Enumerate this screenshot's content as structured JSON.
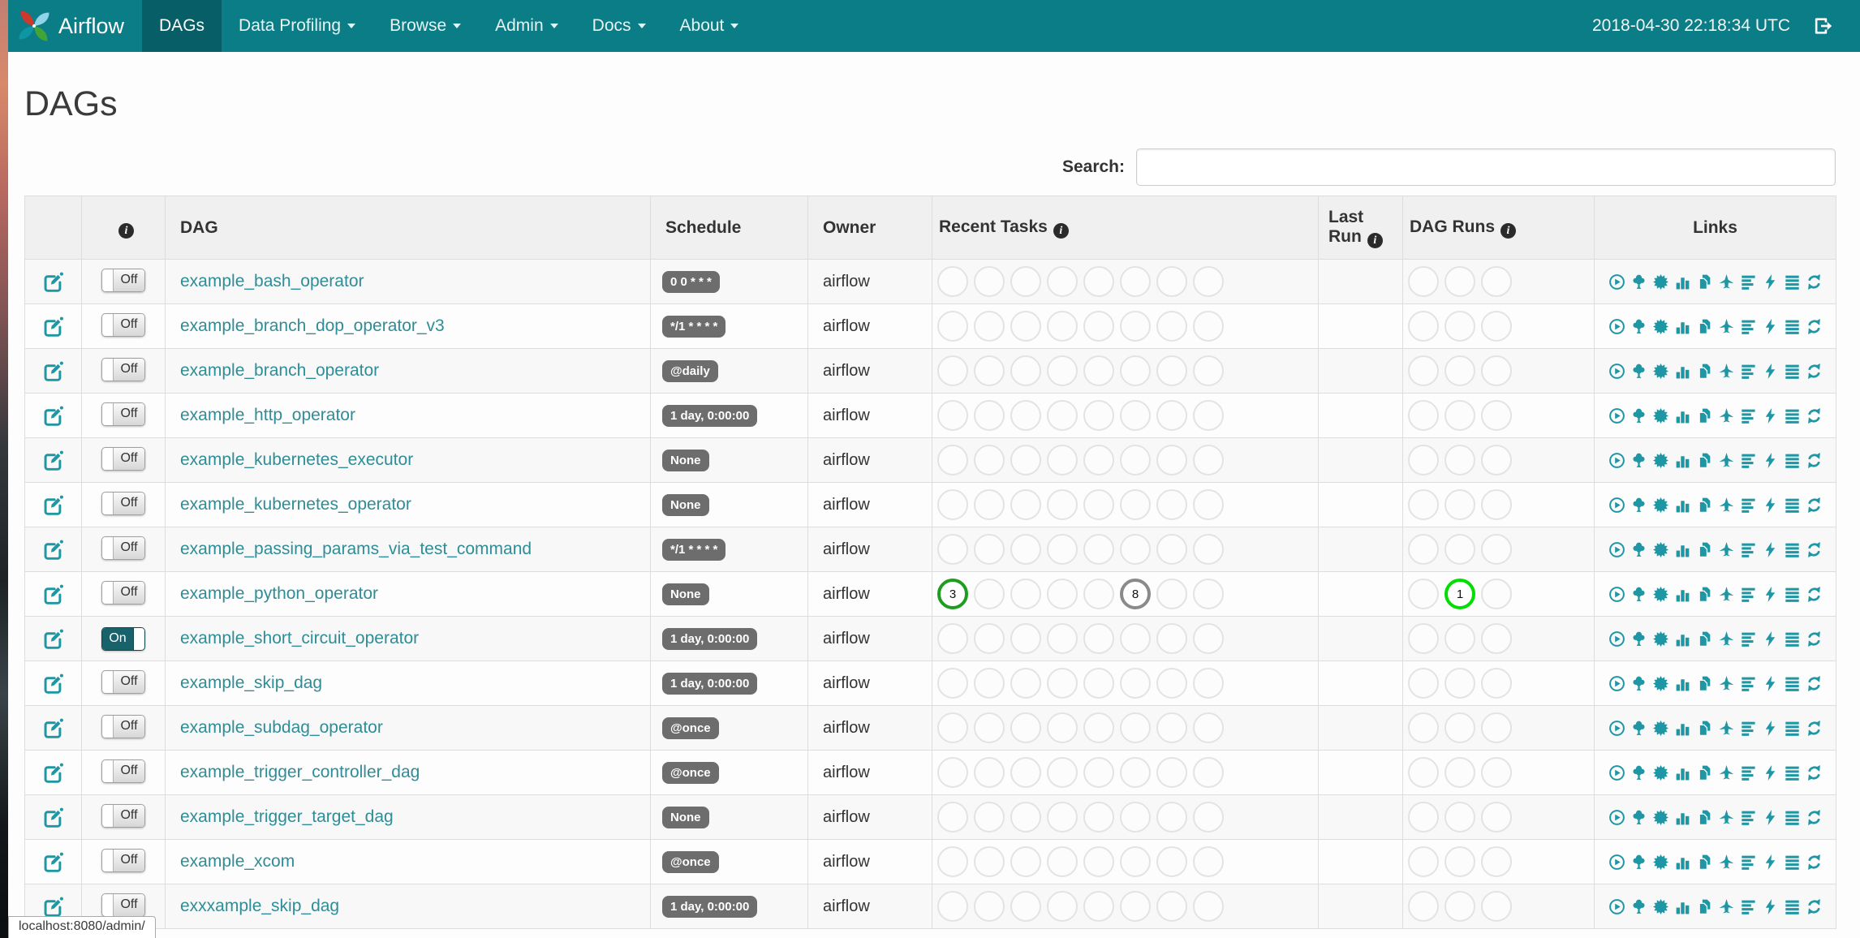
{
  "navbar": {
    "brand": "Airflow",
    "items": [
      {
        "label": "DAGs",
        "active": true,
        "caret": false
      },
      {
        "label": "Data Profiling",
        "active": false,
        "caret": true
      },
      {
        "label": "Browse",
        "active": false,
        "caret": true
      },
      {
        "label": "Admin",
        "active": false,
        "caret": true
      },
      {
        "label": "Docs",
        "active": false,
        "caret": true
      },
      {
        "label": "About",
        "active": false,
        "caret": true
      }
    ],
    "clock": "2018-04-30 22:18:34 UTC",
    "logout_icon": "log-out-icon"
  },
  "page": {
    "title": "DAGs",
    "search_label": "Search:",
    "search_value": "",
    "status_bar": "localhost:8080/admin/"
  },
  "colors": {
    "navbar_bg": "#0b7d86",
    "navbar_active_bg": "#085e66",
    "link_teal": "#2e8d96",
    "icon_teal": "#1f96a4",
    "badge_bg": "#6d6d6d",
    "toggle_on_bg": "#17626b",
    "states": {
      "success": "#1f9d1f",
      "running": "#00df00",
      "none": "#8a8a8a"
    }
  },
  "table": {
    "headers": [
      {
        "label": "",
        "info": false
      },
      {
        "label": "",
        "info": true
      },
      {
        "label": "DAG",
        "info": false
      },
      {
        "label": "Schedule",
        "info": false
      },
      {
        "label": "Owner",
        "info": false
      },
      {
        "label": "Recent Tasks",
        "info": true
      },
      {
        "label": "Last Run",
        "info": true
      },
      {
        "label": "DAG Runs",
        "info": true
      },
      {
        "label": "Links",
        "info": false
      }
    ],
    "recent_task_slots": 8,
    "dag_run_slots": 3,
    "links": [
      "play-circle",
      "tree",
      "sunburst",
      "bar-chart",
      "duplicate",
      "plane",
      "align-left",
      "bolt",
      "align-justify",
      "refresh"
    ],
    "rows": [
      {
        "dag_id": "example_bash_operator",
        "toggle": "Off",
        "schedule": "0 0 * * *",
        "owner": "airflow",
        "last_run": "",
        "recent_tasks": [],
        "dag_runs": []
      },
      {
        "dag_id": "example_branch_dop_operator_v3",
        "toggle": "Off",
        "schedule": "*/1 * * * *",
        "owner": "airflow",
        "last_run": "",
        "recent_tasks": [],
        "dag_runs": []
      },
      {
        "dag_id": "example_branch_operator",
        "toggle": "Off",
        "schedule": "@daily",
        "owner": "airflow",
        "last_run": "",
        "recent_tasks": [],
        "dag_runs": []
      },
      {
        "dag_id": "example_http_operator",
        "toggle": "Off",
        "schedule": "1 day, 0:00:00",
        "owner": "airflow",
        "last_run": "",
        "recent_tasks": [],
        "dag_runs": []
      },
      {
        "dag_id": "example_kubernetes_executor",
        "toggle": "Off",
        "schedule": "None",
        "owner": "airflow",
        "last_run": "",
        "recent_tasks": [],
        "dag_runs": []
      },
      {
        "dag_id": "example_kubernetes_operator",
        "toggle": "Off",
        "schedule": "None",
        "owner": "airflow",
        "last_run": "",
        "recent_tasks": [],
        "dag_runs": []
      },
      {
        "dag_id": "example_passing_params_via_test_command",
        "toggle": "Off",
        "schedule": "*/1 * * * *",
        "owner": "airflow",
        "last_run": "",
        "recent_tasks": [],
        "dag_runs": []
      },
      {
        "dag_id": "example_python_operator",
        "toggle": "Off",
        "schedule": "None",
        "owner": "airflow",
        "last_run": "",
        "recent_tasks": [
          {
            "slot": 0,
            "count": 3,
            "state": "success"
          },
          {
            "slot": 5,
            "count": 8,
            "state": "none"
          }
        ],
        "dag_runs": [
          {
            "slot": 1,
            "count": 1,
            "state": "running"
          }
        ]
      },
      {
        "dag_id": "example_short_circuit_operator",
        "toggle": "On",
        "schedule": "1 day, 0:00:00",
        "owner": "airflow",
        "last_run": "",
        "recent_tasks": [],
        "dag_runs": []
      },
      {
        "dag_id": "example_skip_dag",
        "toggle": "Off",
        "schedule": "1 day, 0:00:00",
        "owner": "airflow",
        "last_run": "",
        "recent_tasks": [],
        "dag_runs": []
      },
      {
        "dag_id": "example_subdag_operator",
        "toggle": "Off",
        "schedule": "@once",
        "owner": "airflow",
        "last_run": "",
        "recent_tasks": [],
        "dag_runs": []
      },
      {
        "dag_id": "example_trigger_controller_dag",
        "toggle": "Off",
        "schedule": "@once",
        "owner": "airflow",
        "last_run": "",
        "recent_tasks": [],
        "dag_runs": []
      },
      {
        "dag_id": "example_trigger_target_dag",
        "toggle": "Off",
        "schedule": "None",
        "owner": "airflow",
        "last_run": "",
        "recent_tasks": [],
        "dag_runs": []
      },
      {
        "dag_id": "example_xcom",
        "toggle": "Off",
        "schedule": "@once",
        "owner": "airflow",
        "last_run": "",
        "recent_tasks": [],
        "dag_runs": []
      },
      {
        "dag_id": "exxxample_skip_dag",
        "toggle": "Off",
        "schedule": "1 day, 0:00:00",
        "owner": "airflow",
        "last_run": "",
        "recent_tasks": [],
        "dag_runs": []
      }
    ]
  }
}
